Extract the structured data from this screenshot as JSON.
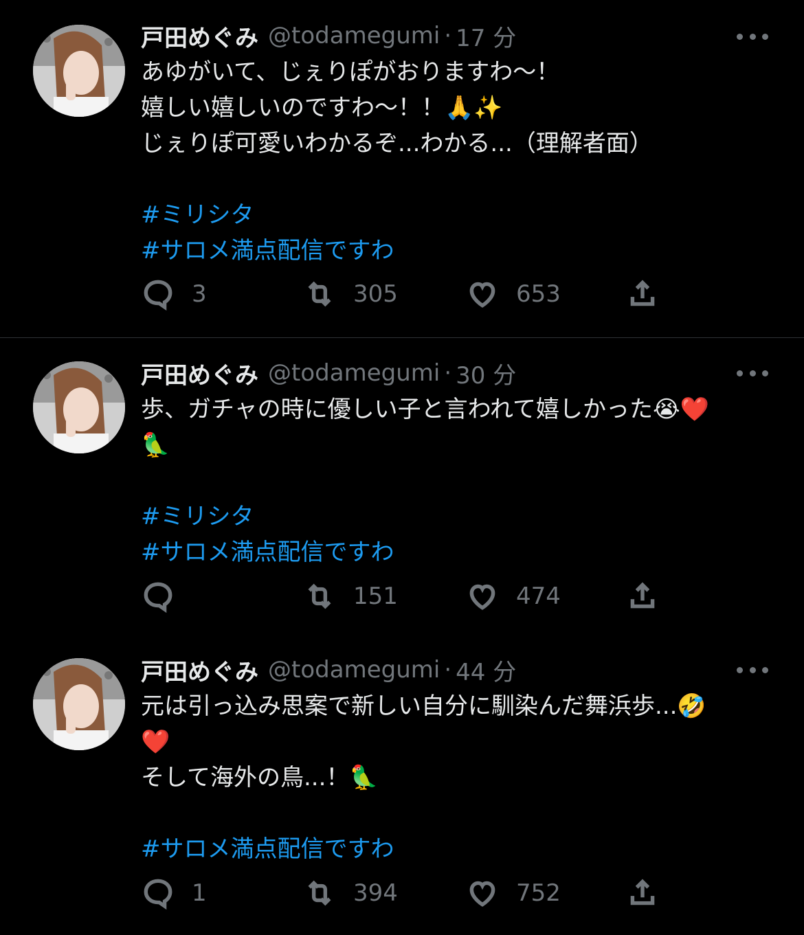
{
  "tweets": [
    {
      "name": "戸田めぐみ",
      "handle": "@todamegumi",
      "sep": "·",
      "time": "17 分",
      "lines": [
        "あゆがいて、じぇりぽがおりますわ〜！",
        "嬉しい嬉しいのですわ〜！！🙏✨",
        "じぇりぽ可愛いわかるぞ...わかる...（理解者面）"
      ],
      "hashtags": [
        "#ミリシタ",
        "#サロメ満点配信ですわ"
      ],
      "reply_count": "3",
      "retweet_count": "305",
      "like_count": "653"
    },
    {
      "name": "戸田めぐみ",
      "handle": "@todamegumi",
      "sep": "·",
      "time": "30 分",
      "lines": [
        "歩、ガチャの時に優しい子と言われて嬉しかった😭❤️",
        "🦜"
      ],
      "hashtags": [
        "#ミリシタ",
        "#サロメ満点配信ですわ"
      ],
      "reply_count": "",
      "retweet_count": "151",
      "like_count": "474"
    },
    {
      "name": "戸田めぐみ",
      "handle": "@todamegumi",
      "sep": "·",
      "time": "44 分",
      "lines": [
        "元は引っ込み思案で新しい自分に馴染んだ舞浜歩...🤣",
        "❤️",
        "そして海外の鳥...！🦜"
      ],
      "hashtags": [
        "#サロメ満点配信ですわ"
      ],
      "reply_count": "1",
      "retweet_count": "394",
      "like_count": "752"
    }
  ],
  "icons": {
    "reply": "speech-bubble-icon",
    "retweet": "retweet-arrows-icon",
    "like": "heart-outline-icon",
    "share": "share-upload-icon",
    "more": "three-dots-icon"
  },
  "colors": {
    "background": "#000000",
    "text": "#e7e9ea",
    "secondary": "#71767b",
    "hashtag": "#1d9bf0",
    "divider": "#2f3336"
  }
}
